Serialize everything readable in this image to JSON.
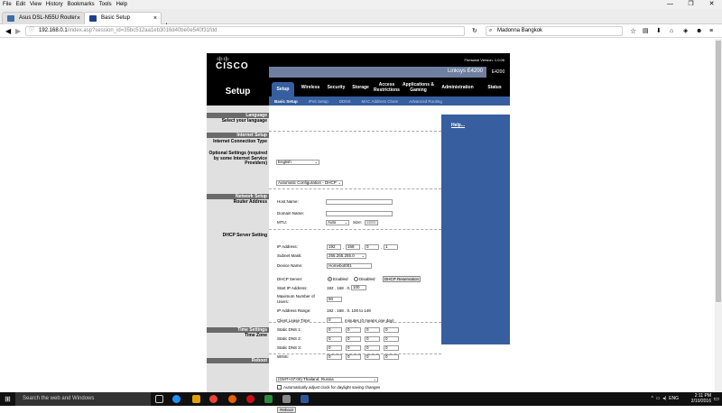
{
  "browser": {
    "menu": [
      "File",
      "Edit",
      "View",
      "History",
      "Bookmarks",
      "Tools",
      "Help"
    ],
    "tabs": [
      {
        "label": "Asus DSL-N55U Router Wi...",
        "color": "#3b6ea5"
      },
      {
        "label": "Basic Setup",
        "color": "#1c3f8c"
      }
    ],
    "url_host": "192.168.0.1",
    "url_path": "/index.asp?session_id=35bc512aa1eb3016d40be0e540f31fdd",
    "search_text": "Madonna Bangkok"
  },
  "router": {
    "firmware": "Firmware Version: 1.0.06",
    "product": "Linksys E4200",
    "model": "E4200",
    "page_title": "Setup",
    "nav_tabs": [
      "Setup",
      "Wireless",
      "Security",
      "Storage",
      "Access Restrictions",
      "Applications & Gaming",
      "Administration",
      "Status"
    ],
    "sub_tabs": [
      "Basic Setup",
      "IPv6 Setup",
      "DDNS",
      "MAC Address Clone",
      "Advanced Routing"
    ],
    "help_label": "Help...",
    "sections": {
      "language": "Language",
      "select_language": "Select your language",
      "internet_setup": "Internet Setup",
      "connection_type": "Internet Connection Type",
      "optional_settings": "Optional Settings (required by some Internet Service Providers)",
      "network_setup": "Network Setup",
      "router_address": "Router Address",
      "dhcp_settings": "DHCP Server Setting",
      "time_settings": "Time Settings",
      "time_zone": "Time Zone",
      "reboot": "Reboot"
    },
    "form": {
      "language_value": "English",
      "connection_value": "Automatic Configuration - DHCP",
      "host_name_label": "Host Name:",
      "host_name": "",
      "domain_name_label": "Domain Name:",
      "domain_name": "",
      "mtu_label": "MTU:",
      "mtu_value": "Auto",
      "size_label": "Size:",
      "size_value": "1500",
      "ip_label": "IP Address:",
      "ip": [
        "192",
        "168",
        "0",
        "1"
      ],
      "subnet_label": "Subnet Mask:",
      "subnet_value": "255.255.255.0",
      "device_name_label": "Device Name:",
      "device_name": "Homebot001",
      "dhcp_server_label": "DHCP Server:",
      "enabled_label": "Enabled",
      "disabled_label": "Disabled",
      "dhcp_reservation": "DHCP Reservation",
      "start_ip_label": "Start IP Address:",
      "start_ip_prefix": "192 . 168 . 0.",
      "start_ip_last": "100",
      "max_users_label": "Maximum Number of Users:",
      "max_users": "50",
      "ip_range_label": "IP Address Range:",
      "ip_range": "192 . 168 . 0. 100 to 149",
      "lease_label": "Client Lease Time:",
      "lease_value": "0",
      "lease_suffix": "minutes (0 means one day)",
      "dns1_label": "Static DNS 1:",
      "dns2_label": "Static DNS 2:",
      "dns3_label": "Static DNS 3:",
      "wins_label": "WINS:",
      "zero": "0",
      "timezone_value": "(GMT+07:00) Thailand, Russia",
      "dst_label": "Automatically adjust clock for daylight saving changes",
      "reboot_button": "Reboot"
    }
  },
  "taskbar": {
    "search_placeholder": "Search the web and Windows",
    "lang": "ENG",
    "time": "2:11 PM",
    "date": "2/10/2016"
  }
}
